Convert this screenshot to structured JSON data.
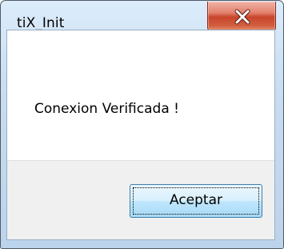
{
  "window": {
    "title": "tiX_Init"
  },
  "dialog": {
    "message": "Conexion Verificada !",
    "ok_label": "Aceptar"
  },
  "icons": {
    "close": "close-icon"
  },
  "colors": {
    "close_button": "#c8452c",
    "ok_button_border": "#3c7fb1",
    "frame": "#c7dcf1"
  }
}
